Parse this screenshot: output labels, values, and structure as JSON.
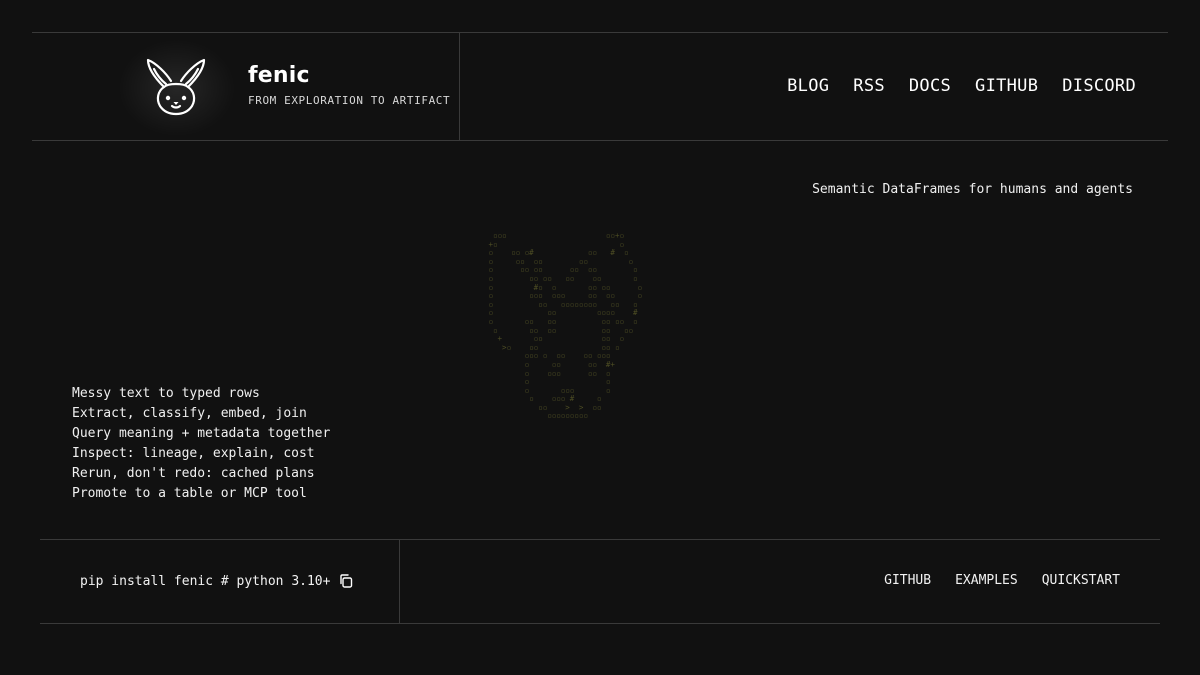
{
  "header": {
    "brand_name": "fenic",
    "tagline": "FROM EXPLORATION TO ARTIFACT",
    "logo_icon": "fennec-fox-icon",
    "nav": [
      "BLOG",
      "RSS",
      "DOCS",
      "GITHUB",
      "DISCORD"
    ]
  },
  "hero": {
    "subtitle": "Semantic DataFrames for humans and agents",
    "art": "fennec-fox-ascii-art",
    "features": [
      "Messy text to typed rows",
      "Extract, classify, embed, join",
      "Query meaning + metadata together",
      "Inspect: lineage, explain, cost",
      "Rerun, don't redo: cached plans",
      "Promote to a table or MCP tool"
    ]
  },
  "footer": {
    "install_command": "pip install fenic # python 3.10+",
    "copy_icon": "copy-icon",
    "links": [
      "GITHUB",
      "EXAMPLES",
      "QUICKSTART"
    ]
  },
  "colors": {
    "background": "#111111",
    "text": "#f2f2f2",
    "border": "#3a3a3a",
    "ascii_art": "#4d4d24"
  }
}
